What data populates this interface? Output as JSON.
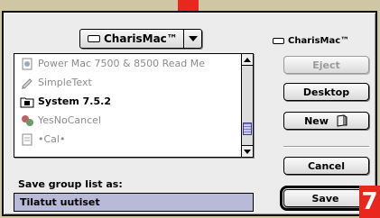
{
  "popup": {
    "volume_name": "CharisMac™"
  },
  "volume_label": "CharisMac™",
  "files": [
    {
      "name": "Power Mac 7500 & 8500 Read Me",
      "style": "dim",
      "icon": "document-icon"
    },
    {
      "name": "SimpleText",
      "style": "dim",
      "icon": "simpletext-app-icon"
    },
    {
      "name": "System 7.5.2",
      "style": "bold",
      "icon": "system-folder-icon"
    },
    {
      "name": "YesNoCancel",
      "style": "dim",
      "icon": "app-icon"
    },
    {
      "name": "•Cal•",
      "style": "dim",
      "icon": "document-icon"
    }
  ],
  "buttons": {
    "eject": "Eject",
    "desktop": "Desktop",
    "new": "New",
    "cancel": "Cancel",
    "save": "Save"
  },
  "save_prompt": {
    "label": "Save group list as:",
    "value": "Tilatut uutiset"
  },
  "badge": {
    "text": "7"
  },
  "colors": {
    "background": "#cfc6a4",
    "badge": "#e8281e",
    "selection": "#b9b9d8"
  }
}
